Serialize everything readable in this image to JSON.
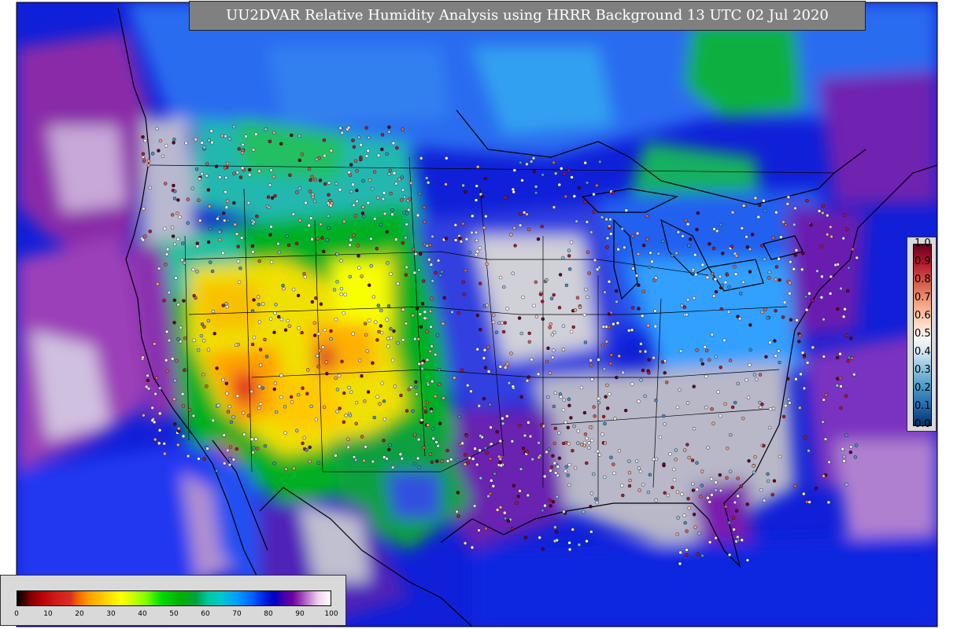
{
  "title": "UU2DVAR Relative Humidity Analysis using HRRR Background 13 UTC 02 Jul 2020",
  "rh_colorbar": {
    "ticks": [
      "0",
      "10",
      "20",
      "30",
      "40",
      "50",
      "60",
      "70",
      "80",
      "90",
      "100"
    ]
  },
  "ob_colorbar": {
    "ticks": [
      "1.0",
      "0.9",
      "0.8",
      "0.7",
      "0.6",
      "0.5",
      "0.4",
      "0.3",
      "0.2",
      "0.1",
      "0.0"
    ]
  },
  "colors": {
    "ocean_moist": "#0000d0",
    "very_humid": "#7000a0",
    "saturated": "#d8d8d8",
    "mid_humidity": "#00a0ff",
    "moderate": "#00b000",
    "dry": "#ffd000",
    "very_dry": "#d02020"
  }
}
